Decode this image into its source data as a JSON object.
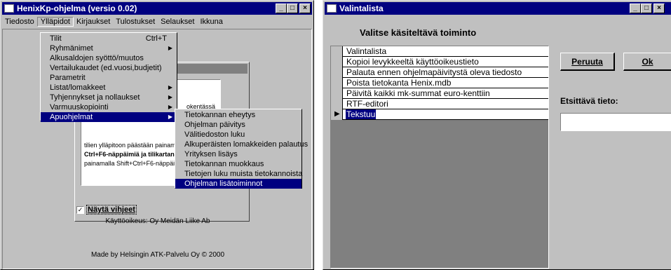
{
  "left_window": {
    "title": "HenixKp-ohjelma (versio 0.02)",
    "menu": [
      "Tiedosto",
      "Ylläpidot",
      "Kirjaukset",
      "Tulostukset",
      "Selaukset",
      "Ikkuna"
    ],
    "controls": {
      "minimize": "_",
      "maximize": "□",
      "close": "×"
    },
    "dropdown_main": [
      {
        "label": "Tilit",
        "shortcut": "Ctrl+T",
        "submenu": false
      },
      {
        "label": "Ryhmänimet",
        "shortcut": "",
        "submenu": true
      },
      {
        "label": "Alkusaldojen syöttö/muutos",
        "shortcut": "",
        "submenu": false
      },
      {
        "label": "Vertailukaudet (ed.vuosi,budjetit)",
        "shortcut": "",
        "submenu": false
      },
      {
        "label": "Parametrit",
        "shortcut": "",
        "submenu": false
      },
      {
        "label": "Listat/lomakkeet",
        "shortcut": "",
        "submenu": true
      },
      {
        "label": "Tyhjennykset ja nollaukset",
        "shortcut": "",
        "submenu": true
      },
      {
        "label": "Varmuuskopiointi",
        "shortcut": "",
        "submenu": true
      },
      {
        "label": "Apuohjelmat",
        "shortcut": "",
        "submenu": true
      }
    ],
    "dropdown_sub": [
      "Tietokannan eheytys",
      "Ohjelman päivitys",
      "Välitiedoston luku",
      "Alkuperäisten lomakkeiden palautus",
      "Yrityksen lisäys",
      "Tietokannan muokkaus",
      "Tietojen luku muista tietokannoista",
      "Ohjelman lisätoiminnot"
    ],
    "hint_partial": "okentässä",
    "hint_lines": [
      "tilien ylläpitoon päästään painam",
      "Ctrl+F6-näppäimiä ja tilikartan se",
      "painamalla Shift+Ctrl+F6-näppäi"
    ],
    "hint_checkbox_label": "Näytä vihjeet",
    "license": "Käyttöoikeus: Oy Meidän Liike Ab",
    "made_by": "Made by Helsingin ATK-Palvelu Oy © 2000"
  },
  "right_window": {
    "title": "Valintalista",
    "heading": "Valitse käsiteltävä toiminto",
    "controls": {
      "minimize": "_",
      "maximize": "□",
      "close": "×"
    },
    "list_header": "Valintalista",
    "list_items": [
      "Kopioi levykkeeltä käyttöoikeustieto",
      "Palauta ennen ohjelmapäivitystä oleva tiedosto",
      "Poista tietokanta Henix.mdb",
      "Päivitä kaikki mk-summat euro-kenttiin",
      "RTF-editori",
      "Tekstuu"
    ],
    "cancel_label": "Peruuta",
    "ok_label": "Ok",
    "search_label": "Etsittävä tieto:",
    "search_value": ""
  }
}
